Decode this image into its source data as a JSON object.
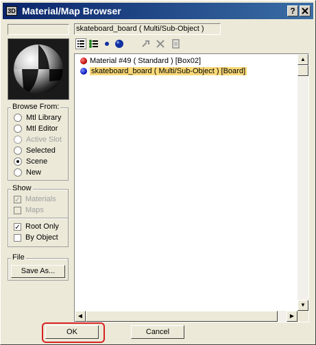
{
  "window": {
    "title": "Material/Map Browser",
    "help_button": "?",
    "close_button": "X"
  },
  "material_name_field": {
    "value": "skateboard_board  ( Multi/Sub-Object )"
  },
  "browse_from": {
    "label": "Browse From:",
    "options": [
      {
        "label": "Mtl Library",
        "checked": false,
        "disabled": false
      },
      {
        "label": "Mtl Editor",
        "checked": false,
        "disabled": false
      },
      {
        "label": "Active Slot",
        "checked": false,
        "disabled": true
      },
      {
        "label": "Selected",
        "checked": false,
        "disabled": false
      },
      {
        "label": "Scene",
        "checked": true,
        "disabled": false
      },
      {
        "label": "New",
        "checked": false,
        "disabled": false
      }
    ]
  },
  "show": {
    "label": "Show",
    "options": [
      {
        "label": "Materials",
        "checked": true,
        "disabled": true
      },
      {
        "label": "Maps",
        "checked": false,
        "disabled": true
      },
      {
        "label": "Root Only",
        "checked": true,
        "disabled": false
      },
      {
        "label": "By Object",
        "checked": false,
        "disabled": false
      }
    ]
  },
  "file": {
    "label": "File",
    "save_as_label": "Save As..."
  },
  "materials_list": [
    {
      "text": "Material #49  ( Standard )  [Box02]",
      "ball_color": "#c01010",
      "selected": false
    },
    {
      "text": "skateboard_board  ( Multi/Sub-Object )  [Board]",
      "ball_color": "#1020c0",
      "selected": true
    }
  ],
  "buttons": {
    "ok_label": "OK",
    "cancel_label": "Cancel"
  },
  "colors": {
    "selection": "#f8d878",
    "highlight_ring": "#d62020"
  }
}
